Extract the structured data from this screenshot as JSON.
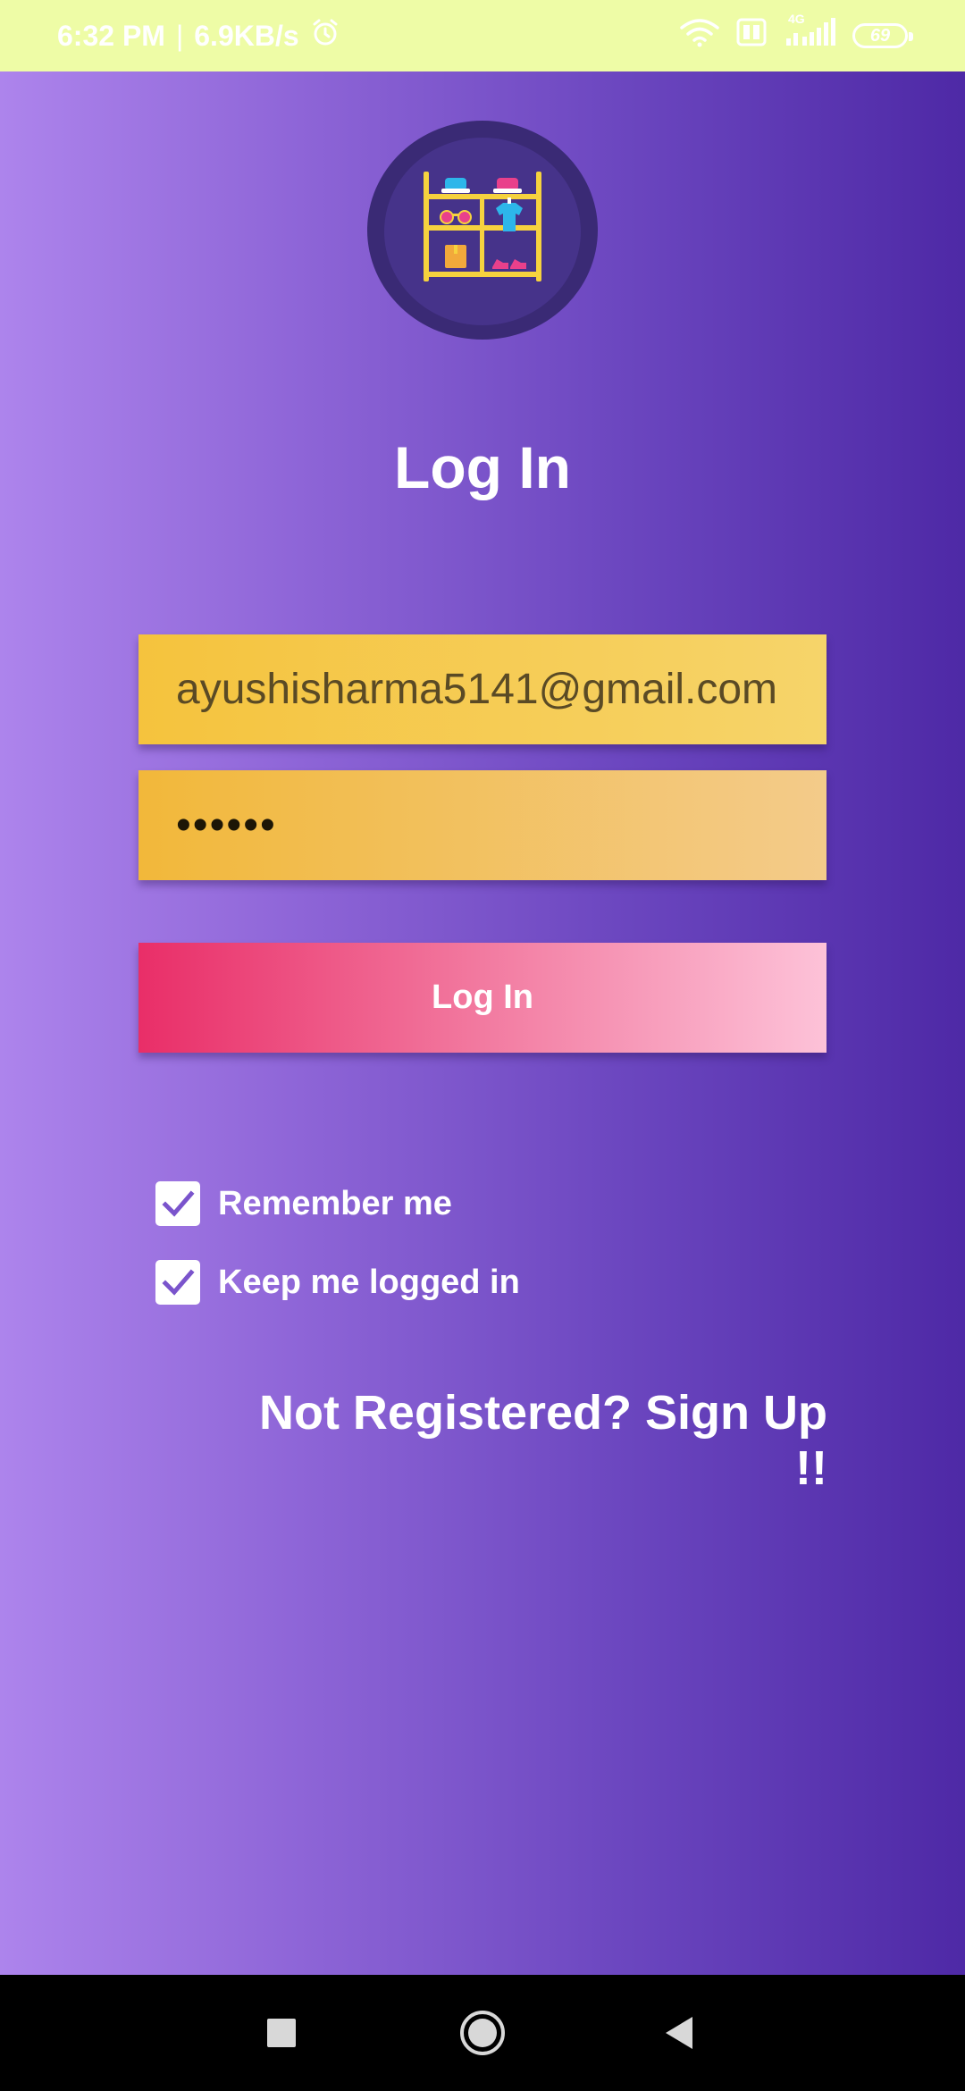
{
  "status_bar": {
    "time": "6:32 PM",
    "separator": "|",
    "speed": "6.9KB/s",
    "network": "4G",
    "battery": "69",
    "icons": [
      "alarm-icon",
      "wifi-icon",
      "volte-icon",
      "signal-icon",
      "battery-icon"
    ]
  },
  "login": {
    "title": "Log In",
    "email_value": "ayushisharma5141@gmail.com",
    "password_value": "••••••",
    "button_label": "Log In",
    "remember_label": "Remember me",
    "remember_checked": true,
    "keep_label": "Keep me logged in",
    "keep_checked": true,
    "signup_label": "Not Registered? Sign Up !!"
  },
  "nav_bar": {
    "icons": [
      "recents-icon",
      "home-icon",
      "back-icon"
    ]
  },
  "colors": {
    "status_bar_bg": "#eefca6",
    "gradient_start": "#ad84ec",
    "gradient_end": "#4e29a6",
    "email_field": "#f5c33d",
    "password_field": "#f2b83a",
    "button_start": "#e92e68",
    "button_end": "#fdc2d8"
  }
}
